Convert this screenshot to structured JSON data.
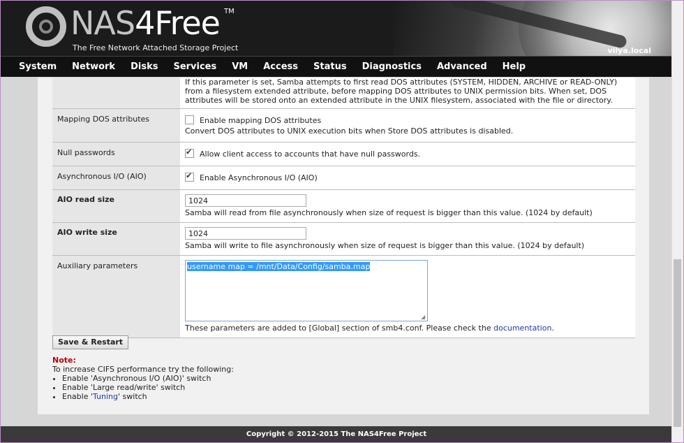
{
  "header": {
    "logo_text_nas": "NAS",
    "logo_text_4free": "4Free",
    "logo_tm": "TM",
    "tagline": "The Free Network Attached Storage Project",
    "hostname": "vilya.local"
  },
  "nav": [
    "System",
    "Network",
    "Disks",
    "Services",
    "VM",
    "Access",
    "Status",
    "Diagnostics",
    "Advanced",
    "Help"
  ],
  "rows": {
    "store_dos_desc": "If this parameter is set, Samba attempts to first read DOS attributes (SYSTEM, HIDDEN, ARCHIVE or READ-ONLY) from a filesystem extended attribute, before mapping DOS attributes to UNIX permission bits. When set, DOS attributes will be stored onto an extended attribute in the UNIX filesystem, associated with the file or directory.",
    "mapping_dos": {
      "label": "Mapping DOS attributes",
      "checkbox": "Enable mapping DOS attributes",
      "checked": false,
      "desc": "Convert DOS attributes to UNIX execution bits when Store DOS attributes is disabled."
    },
    "null_passwords": {
      "label": "Null passwords",
      "checkbox": "Allow client access to accounts that have null passwords.",
      "checked": true
    },
    "aio": {
      "label": "Asynchronous I/O (AIO)",
      "checkbox": "Enable Asynchronous I/O (AIO)",
      "checked": true
    },
    "aio_read": {
      "label": "AIO read size",
      "value": "1024",
      "desc": "Samba will read from file asynchronously when size of request is bigger than this value. (1024 by default)"
    },
    "aio_write": {
      "label": "AIO write size",
      "value": "1024",
      "desc": "Samba will write to file asynchronously when size of request is bigger than this value. (1024 by default)"
    },
    "aux": {
      "label": "Auxiliary parameters",
      "value": "username map = /mnt/Data/Config/samba.map",
      "desc": "These parameters are added to [Global] section of smb4.conf. Please check the ",
      "link": "documentation",
      "desc_end": "."
    }
  },
  "save_button": "Save & Restart",
  "note": {
    "title": "Note:",
    "intro": "To increase CIFS performance try the following:",
    "item1": "Enable 'Asynchronous I/O (AIO)' switch",
    "item2": "Enable 'Large read/write' switch",
    "item3_pre": "Enable '",
    "item3_link": "Tuning",
    "item3_post": "' switch"
  },
  "footer": "Copyright © 2012-2015 The NAS4Free Project"
}
